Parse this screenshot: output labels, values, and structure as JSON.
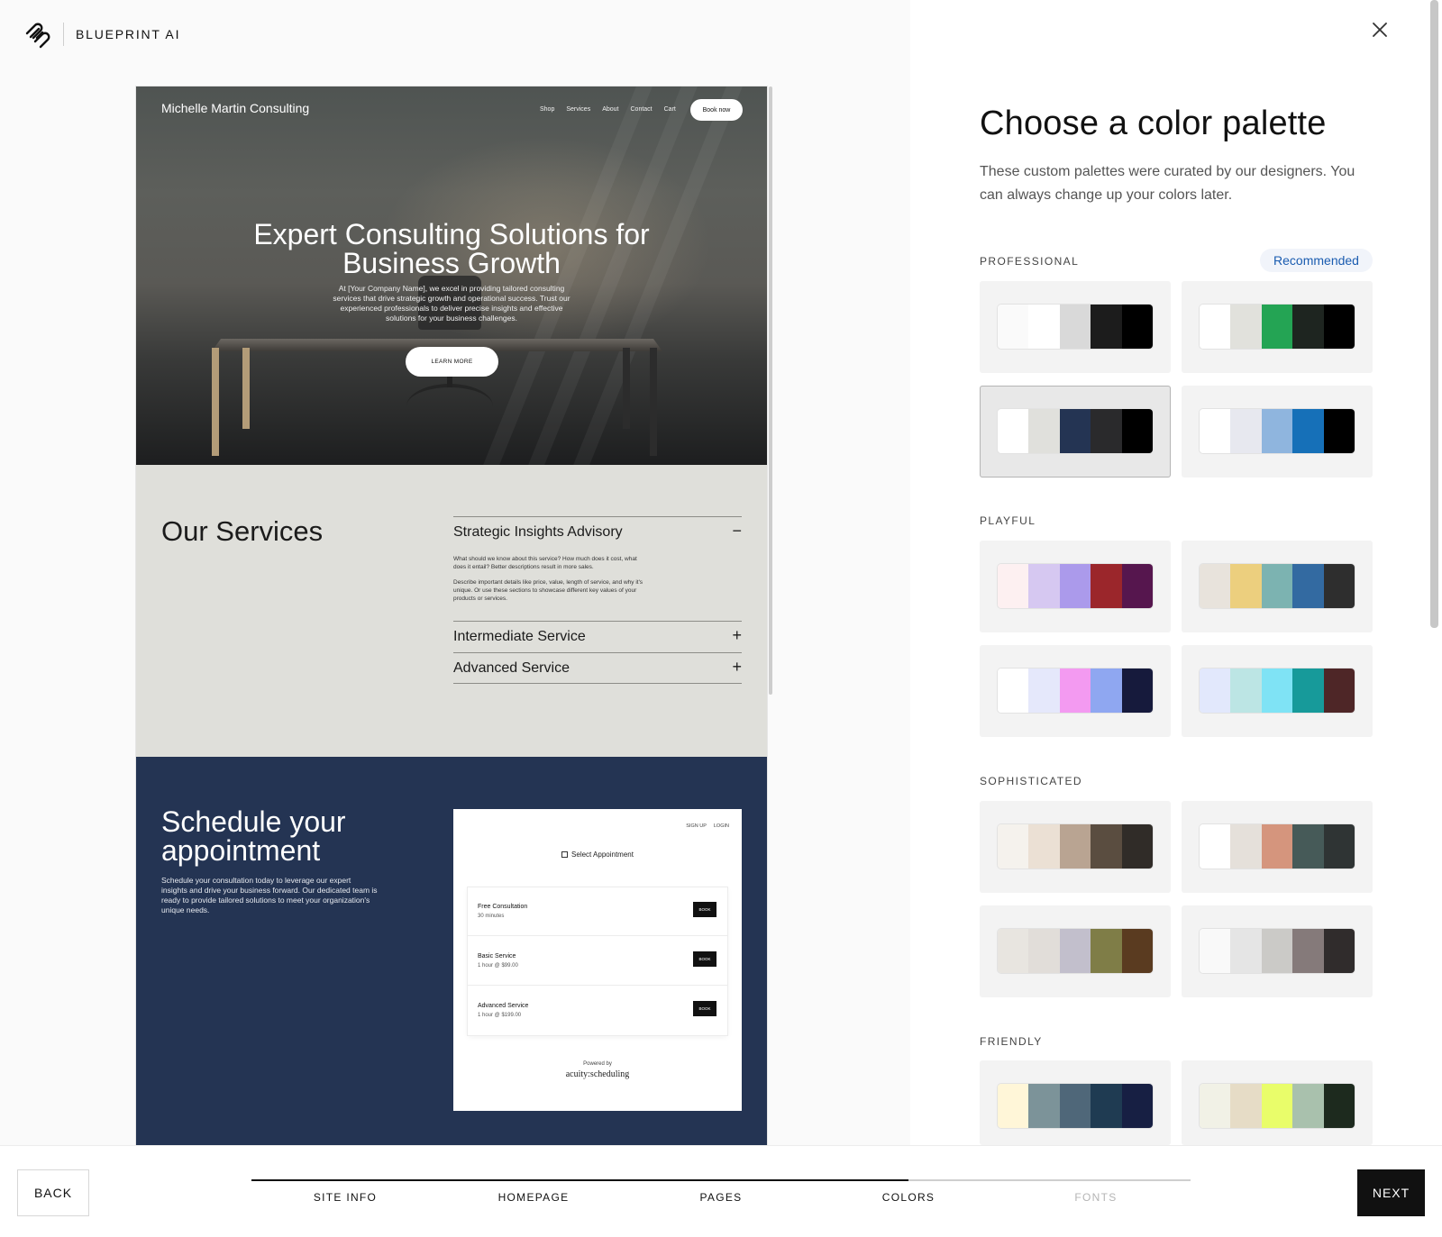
{
  "brand": {
    "name": "BLUEPRINT AI"
  },
  "preview": {
    "site_title": "Michelle Martin Consulting",
    "nav": [
      "Shop",
      "Services",
      "About",
      "Contact",
      "Cart"
    ],
    "book_now": "Book now",
    "hero": {
      "heading": "Expert Consulting Solutions for Business Growth",
      "body": "At [Your Company Name], we excel in providing tailored consulting services that drive strategic growth and operational success. Trust our experienced professionals to deliver precise insights and effective solutions for your business challenges.",
      "cta": "LEARN MORE"
    },
    "services": {
      "heading": "Our Services",
      "items": [
        {
          "title": "Strategic Insights Advisory",
          "toggle": "−",
          "desc1": "What should we know about this service? How much does it cost, what does it entail? Better descriptions result in more sales.",
          "desc2": "Describe important details like price, value, length of service, and why it's unique. Or use these sections to showcase different key values of your products or services."
        },
        {
          "title": "Intermediate Service",
          "toggle": "+"
        },
        {
          "title": "Advanced Service",
          "toggle": "+"
        }
      ]
    },
    "schedule": {
      "heading": "Schedule your appointment",
      "body": "Schedule your consultation today to leverage our expert insights and drive your business forward. Our dedicated team is ready to provide tailored solutions to meet your organization's unique needs.",
      "widget": {
        "sign_up": "SIGN UP",
        "login": "LOGIN",
        "title": "Select Appointment",
        "rows": [
          {
            "name": "Free Consultation",
            "sub": "30 minutes",
            "action": "BOOK"
          },
          {
            "name": "Basic Service",
            "sub": "1 hour @ $99.00",
            "action": "BOOK"
          },
          {
            "name": "Advanced Service",
            "sub": "1 hour @ $199.00",
            "action": "BOOK"
          }
        ],
        "powered_by": "Powered by",
        "provider": "acuity:scheduling"
      }
    }
  },
  "panel": {
    "title": "Choose a color palette",
    "subtitle": "These custom palettes were curated by our designers. You can always change up your colors later.",
    "recommended": "Recommended",
    "groups": [
      {
        "label": "PROFESSIONAL",
        "palettes": [
          [
            "#fafafa",
            "#ffffff",
            "#d9d9d9",
            "#1c1c1c",
            "#000000"
          ],
          [
            "#ffffff",
            "#e1e1dc",
            "#24a454",
            "#1e2520",
            "#000000"
          ],
          [
            "#ffffff",
            "#e0e0dc",
            "#243453",
            "#2a2a2c",
            "#000000"
          ],
          [
            "#ffffff",
            "#e7e8ef",
            "#8fb5de",
            "#1670b8",
            "#000000"
          ]
        ]
      },
      {
        "label": "PLAYFUL",
        "palettes": [
          [
            "#fdf0f1",
            "#d6c8f1",
            "#ab9aeb",
            "#9b262b",
            "#56164e"
          ],
          [
            "#e8e3dc",
            "#eccf7e",
            "#7cb3b1",
            "#336aa1",
            "#2e2e2e"
          ],
          [
            "#ffffff",
            "#e5e8fb",
            "#f39af1",
            "#8fa7f1",
            "#161a3c"
          ],
          [
            "#e2e8fc",
            "#bce5e4",
            "#7fe3f5",
            "#179a9a",
            "#4e2627"
          ]
        ]
      },
      {
        "label": "SOPHISTICATED",
        "palettes": [
          [
            "#f5f2ed",
            "#ebe0d4",
            "#b9a492",
            "#5a4d40",
            "#302c28"
          ],
          [
            "#ffffff",
            "#e5e0da",
            "#d5957d",
            "#465a58",
            "#2f3434"
          ],
          [
            "#e8e5e0",
            "#e1ddd9",
            "#c2bfcc",
            "#7f7d47",
            "#5a3b20"
          ],
          [
            "#f9f9f9",
            "#e5e5e5",
            "#cbcac7",
            "#857a7a",
            "#302c2c"
          ]
        ]
      },
      {
        "label": "FRIENDLY",
        "palettes": [
          [
            "#fff6d8",
            "#7c9399",
            "#4f6779",
            "#1f3b52",
            "#171f43"
          ],
          [
            "#f1f1e6",
            "#e6dcc6",
            "#e9fd6a",
            "#a9c1ad",
            "#1d2a1e"
          ]
        ]
      }
    ]
  },
  "footer": {
    "back": "BACK",
    "next": "NEXT",
    "progress": 0.7,
    "steps": [
      "SITE INFO",
      "HOMEPAGE",
      "PAGES",
      "COLORS",
      "FONTS"
    ]
  }
}
